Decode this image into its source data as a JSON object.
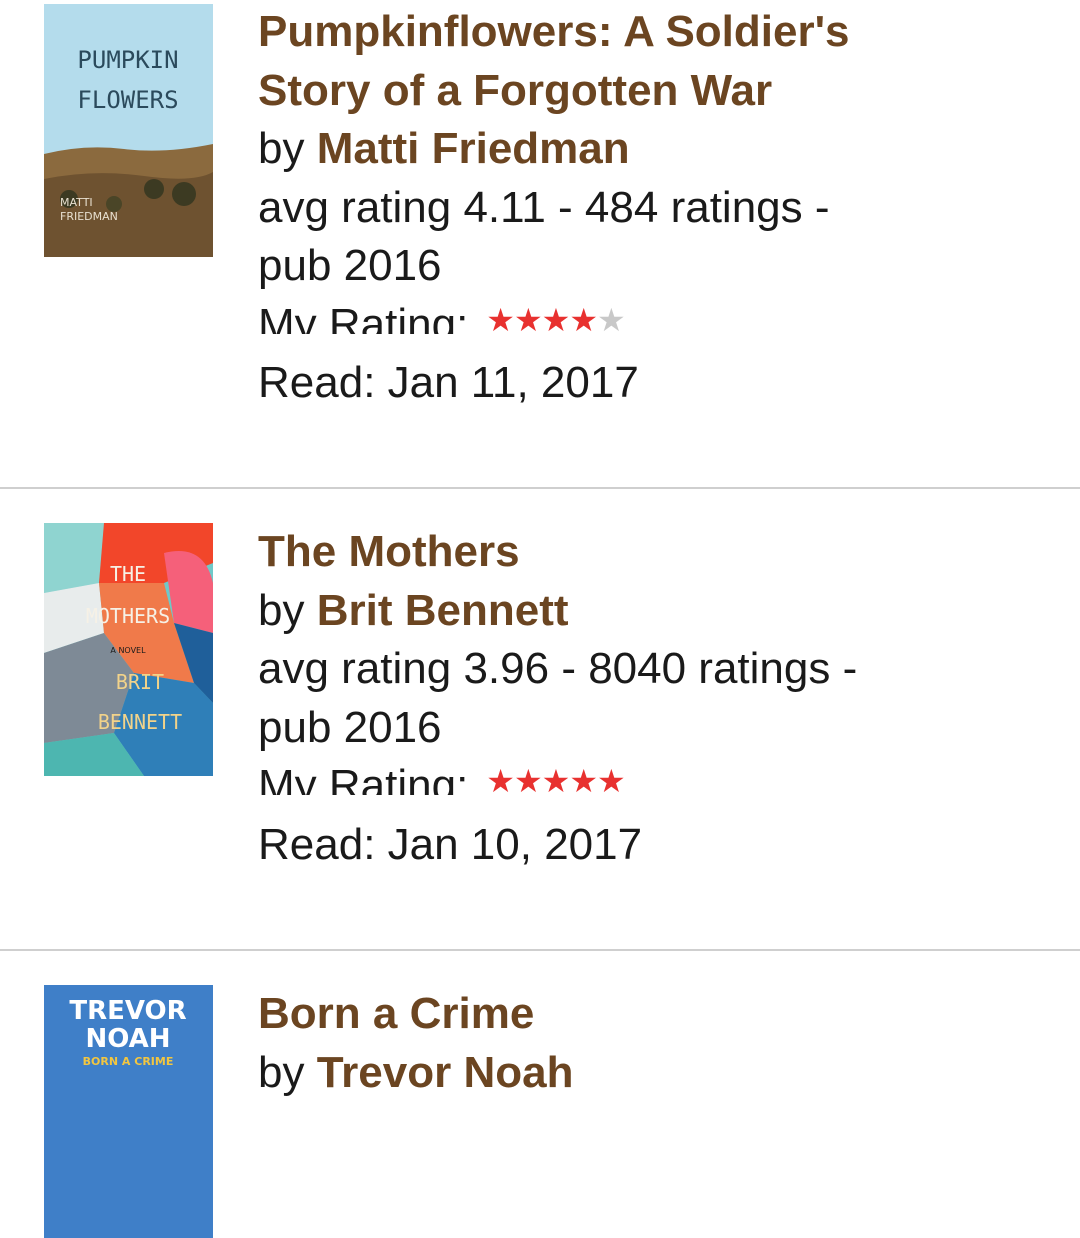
{
  "books": [
    {
      "title": "Pumpkinflowers: A Soldier's Story of a Forgotten War",
      "title_line1": "Pumpkinflowers: A Soldier's",
      "title_line2": "Story of a Forgotten War",
      "by": "by",
      "author": "Matti Friedman",
      "avg_line1": "avg rating 4.11 - 484 ratings -",
      "avg_line2": "pub 2016",
      "my_rating_label": "My Rating:",
      "my_rating": 4,
      "read": "Read: Jan 11, 2017",
      "cover": {
        "line1": "PUMPKIN",
        "line2": "FLOWERS",
        "author1": "MATTI",
        "author2": "FRIEDMAN"
      }
    },
    {
      "title": "The Mothers",
      "by": "by",
      "author": "Brit Bennett",
      "avg_line1": "avg rating 3.96 - 8040 ratings -",
      "avg_line2": "pub 2016",
      "my_rating_label": "My Rating:",
      "my_rating": 5,
      "read": "Read: Jan 10, 2017",
      "cover": {
        "line1": "THE",
        "line2": "MOTHERS",
        "sub": "A NOVEL",
        "author1": "BRIT",
        "author2": "BENNETT"
      }
    },
    {
      "title": "Born a Crime",
      "by": "by",
      "author": "Trevor Noah",
      "cover": {
        "line1": "TREVOR",
        "line2": "NOAH",
        "line3": "BORN A CRIME"
      }
    }
  ],
  "colors": {
    "link_brown": "#6b4521",
    "star_on": "#e8312f",
    "star_off": "#c8c8c8",
    "divider": "#cfcfcf"
  }
}
